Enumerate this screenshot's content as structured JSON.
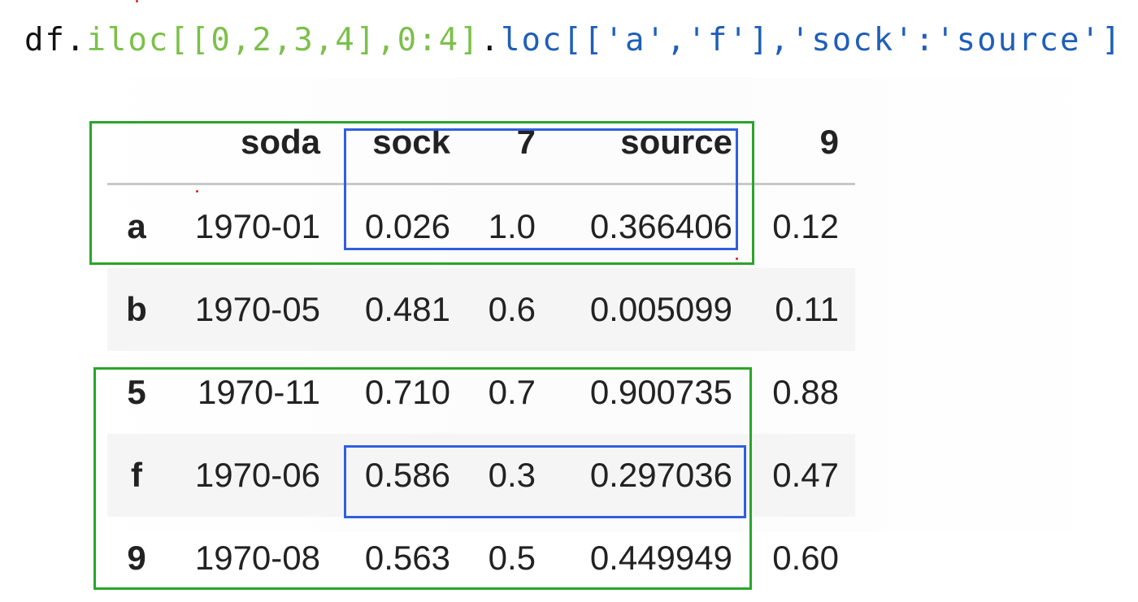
{
  "code": {
    "part_df": "df.",
    "part_iloc": "iloc[[0,2,3,4],0:4]",
    "part_dot": ".",
    "part_loc": "loc[['a','f'],'sock':'source']"
  },
  "table": {
    "columns": [
      "",
      "soda",
      "sock",
      "7",
      "source",
      "9"
    ],
    "rows": [
      {
        "index": "a",
        "soda": "1970-01",
        "sock": "0.026",
        "c7": "1.0",
        "source": "0.366406",
        "c9": "0.12"
      },
      {
        "index": "b",
        "soda": "1970-05",
        "sock": "0.481",
        "c7": "0.6",
        "source": "0.005099",
        "c9": "0.11"
      },
      {
        "index": "5",
        "soda": "1970-11",
        "sock": "0.710",
        "c7": "0.7",
        "source": "0.900735",
        "c9": "0.88"
      },
      {
        "index": "f",
        "soda": "1970-06",
        "sock": "0.586",
        "c7": "0.3",
        "source": "0.297036",
        "c9": "0.47"
      },
      {
        "index": "9",
        "soda": "1970-08",
        "sock": "0.563",
        "c7": "0.5",
        "source": "0.449949",
        "c9": "0.60"
      }
    ]
  },
  "colors": {
    "iloc_highlight": "#2aa52a",
    "loc_highlight": "#2f5fe0"
  }
}
